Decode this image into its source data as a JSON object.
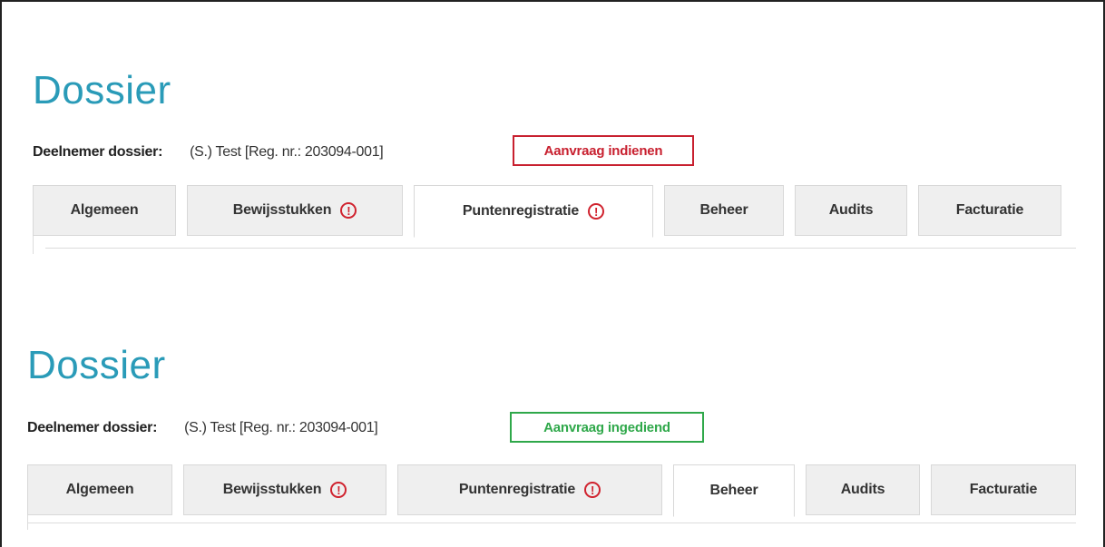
{
  "panels": [
    {
      "title": "Dossier",
      "participant_label": "Deelnemer dossier:",
      "participant_value": "(S.) Test [Reg. nr.: 203094-001]",
      "status_button": "Aanvraag indienen",
      "status_color": "#c8202f",
      "active_tab": "Puntenregistratie",
      "tabs": [
        {
          "label": "Algemeen",
          "warning": false
        },
        {
          "label": "Bewijsstukken",
          "warning": true
        },
        {
          "label": "Puntenregistratie",
          "warning": true
        },
        {
          "label": "Beheer",
          "warning": false
        },
        {
          "label": "Audits",
          "warning": false
        },
        {
          "label": "Facturatie",
          "warning": false
        }
      ]
    },
    {
      "title": "Dossier",
      "participant_label": "Deelnemer dossier:",
      "participant_value": "(S.) Test [Reg. nr.: 203094-001]",
      "status_button": "Aanvraag ingediend",
      "status_color": "#2fa84a",
      "active_tab": "Beheer",
      "tabs": [
        {
          "label": "Algemeen",
          "warning": false
        },
        {
          "label": "Bewijsstukken",
          "warning": true
        },
        {
          "label": "Puntenregistratie",
          "warning": true
        },
        {
          "label": "Beheer",
          "warning": false
        },
        {
          "label": "Audits",
          "warning": false
        },
        {
          "label": "Facturatie",
          "warning": false
        }
      ]
    }
  ],
  "icons": {
    "warning": "exclamation-circle-icon",
    "warning_glyph": "!"
  },
  "colors": {
    "title": "#2a9bb8",
    "warning": "#d0222e",
    "tab_bg": "#efefef"
  }
}
